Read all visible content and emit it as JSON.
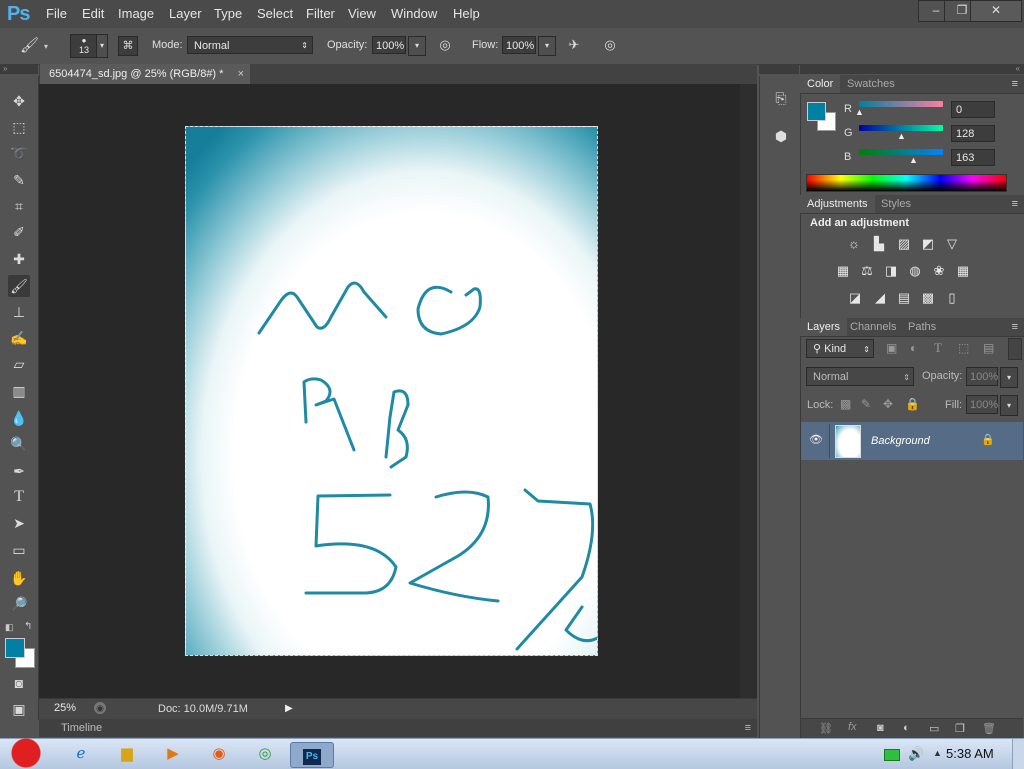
{
  "app": {
    "logo": "Ps"
  },
  "menu": [
    "File",
    "Edit",
    "Image",
    "Layer",
    "Type",
    "Select",
    "Filter",
    "View",
    "Window",
    "Help"
  ],
  "window_controls": {
    "minimize": "–",
    "restore": "❐",
    "close": "✕"
  },
  "options": {
    "brush_size": "13",
    "mode_label": "Mode:",
    "mode_value": "Normal",
    "opacity_label": "Opacity:",
    "opacity_value": "100%",
    "flow_label": "Flow:",
    "flow_value": "100%"
  },
  "document": {
    "tab_title": "6504474_sd.jpg @ 25% (RGB/8#) *",
    "tab_close": "×",
    "zoom": "25%",
    "doc_info": "Doc: 10.0M/9.71M",
    "timeline_label": "Timeline"
  },
  "color_panel": {
    "tabs": [
      "Color",
      "Swatches"
    ],
    "foreground": "#0080a3",
    "r_label": "R",
    "r_value": "0",
    "g_label": "G",
    "g_value": "128",
    "b_label": "B",
    "b_value": "163"
  },
  "adjustments_panel": {
    "tabs": [
      "Adjustments",
      "Styles"
    ],
    "heading": "Add an adjustment"
  },
  "layers_panel": {
    "tabs": [
      "Layers",
      "Channels",
      "Paths"
    ],
    "filter_kind": "Kind",
    "blend_mode": "Normal",
    "opacity_label": "Opacity:",
    "opacity_value": "100%",
    "lock_label": "Lock:",
    "fill_label": "Fill:",
    "fill_value": "100%",
    "layers": [
      {
        "name": "Background",
        "visible": true,
        "locked": true
      }
    ]
  },
  "taskbar": {
    "time": "5:38 AM",
    "apps": [
      "angry-birds",
      "ie",
      "explorer",
      "media-player",
      "firefox",
      "chrome",
      "photoshop"
    ]
  }
}
